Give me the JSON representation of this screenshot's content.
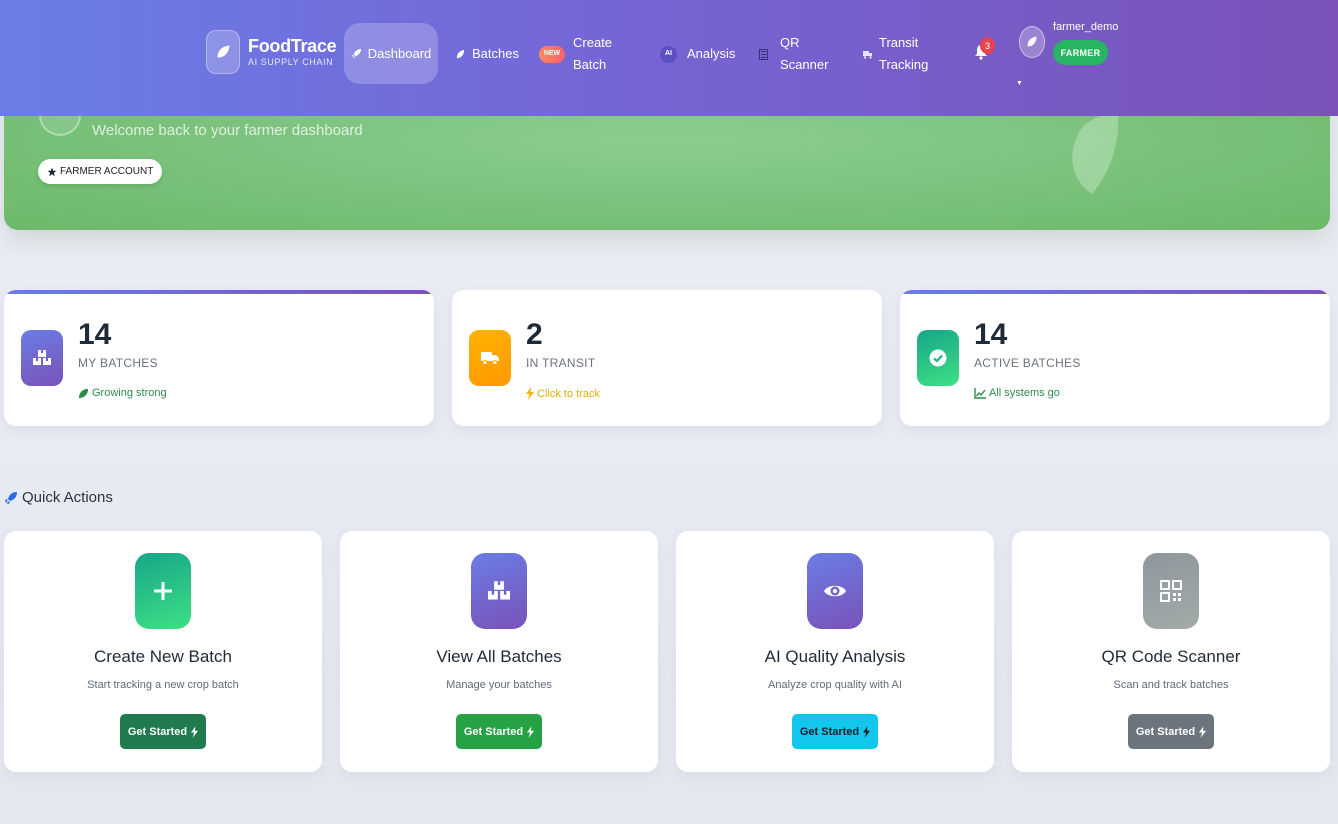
{
  "brand": {
    "name": "FoodTrace",
    "tagline": "AI SUPPLY CHAIN"
  },
  "nav": {
    "dashboard": "Dashboard",
    "batches": "Batches",
    "create_batch": "Create Batch",
    "create_badge": "NEW",
    "analysis": "Analysis",
    "analysis_badge": "AI",
    "qr_scanner": "QR Scanner",
    "transit_tracking": "Transit Tracking",
    "notification_count": "3"
  },
  "user": {
    "name": "farmer_demo",
    "role": "FARMER"
  },
  "hero": {
    "subtitle": "Welcome back to your farmer dashboard",
    "account_pill": "FARMER ACCOUNT"
  },
  "stats": [
    {
      "value": "14",
      "label": "MY BATCHES",
      "note": "Growing strong",
      "icon": "boxes-icon",
      "color": "#6c5fd0",
      "note_color": "#2e8b4a"
    },
    {
      "value": "2",
      "label": "IN TRANSIT",
      "note": "Click to track",
      "icon": "truck-icon",
      "color": "#ffab00",
      "note_color": "#e0b000"
    },
    {
      "value": "14",
      "label": "ACTIVE BATCHES",
      "note": "All systems go",
      "icon": "check-circle-icon",
      "color": "#1fb980",
      "note_color": "#2e8b4a"
    }
  ],
  "quick_actions": {
    "title": "Quick Actions",
    "items": [
      {
        "title": "Create New Batch",
        "desc": "Start tracking a new crop batch",
        "button": "Get Started",
        "icon": "plus-icon",
        "button_color": "#1f7a4d"
      },
      {
        "title": "View All Batches",
        "desc": "Manage your batches",
        "button": "Get Started",
        "icon": "boxes-icon",
        "button_color": "#25a244"
      },
      {
        "title": "AI Quality Analysis",
        "desc": "Analyze crop quality with AI",
        "button": "Get Started",
        "icon": "eye-icon",
        "button_color": "#12c6ec"
      },
      {
        "title": "QR Code Scanner",
        "desc": "Scan and track batches",
        "button": "Get Started",
        "icon": "qrcode-icon",
        "button_color": "#6c757d"
      }
    ]
  },
  "colors": {
    "nav_gradient": [
      "#6a7de6",
      "#7a52b8"
    ],
    "hero_green": "#7dc37f",
    "role_badge": "#27b463",
    "bell_badge": "#e6424f"
  }
}
